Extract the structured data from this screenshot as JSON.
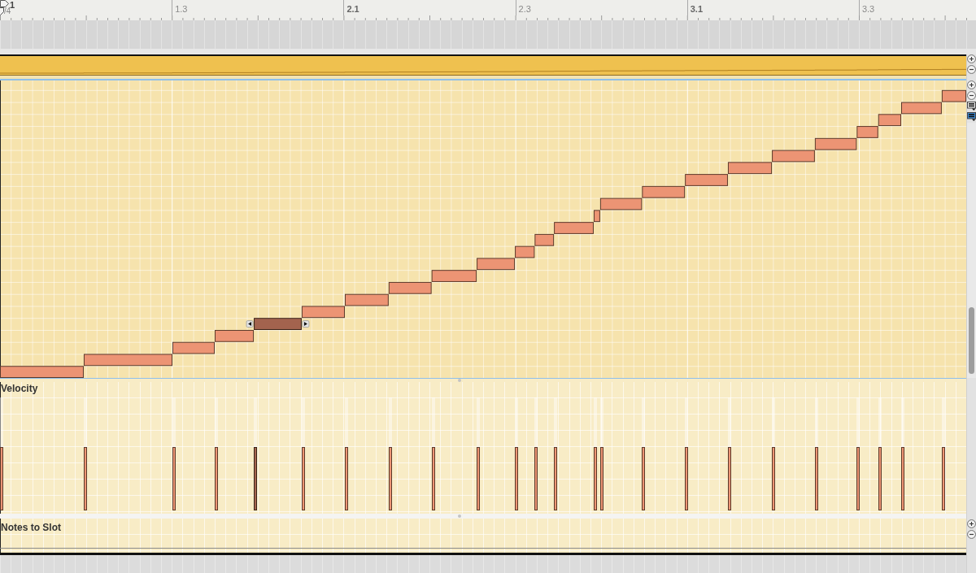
{
  "ruler": {
    "labels": [
      "1",
      "1.3",
      "2.1",
      "2.3",
      "3.1",
      "3.3"
    ],
    "time_signature": "/4"
  },
  "note_editor": {
    "notes": [
      {
        "selected": false,
        "level": 0.56
      },
      {
        "selected": false,
        "level": 0.56
      },
      {
        "selected": false,
        "level": 0.56
      },
      {
        "selected": false,
        "level": 0.56
      },
      {
        "selected": true,
        "level": 0.56
      },
      {
        "selected": false,
        "level": 0.56
      },
      {
        "selected": false,
        "level": 0.56
      },
      {
        "selected": false,
        "level": 0.56
      },
      {
        "selected": false,
        "level": 0.56
      },
      {
        "selected": false,
        "level": 0.56
      },
      {
        "selected": false,
        "level": 0.56
      },
      {
        "selected": false,
        "level": 0.56
      },
      {
        "selected": false,
        "level": 0.56
      },
      {
        "selected": false,
        "level": 0.56
      },
      {
        "selected": false,
        "level": 0.56
      },
      {
        "selected": false,
        "level": 0.56
      },
      {
        "selected": false,
        "level": 0.56
      },
      {
        "selected": false,
        "level": 0.56
      },
      {
        "selected": false,
        "level": 0.56
      },
      {
        "selected": false,
        "level": 0.56
      },
      {
        "selected": false,
        "level": 0.56
      },
      {
        "selected": false,
        "level": 0.56
      },
      {
        "selected": false,
        "level": 0.56
      },
      {
        "selected": false,
        "level": 0.56
      }
    ]
  },
  "lanes": [
    {
      "kind": "velocity",
      "label": "Velocity"
    },
    {
      "kind": "slot",
      "label": "Notes to Slot"
    }
  ]
}
